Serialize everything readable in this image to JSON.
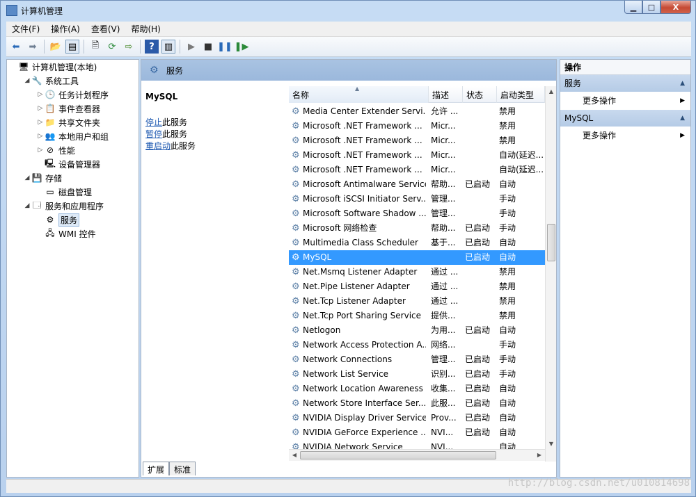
{
  "window": {
    "title": "计算机管理",
    "buttons": {
      "minimize": "▁",
      "maximize": "□",
      "close": "X"
    }
  },
  "menu": [
    "文件(F)",
    "操作(A)",
    "查看(V)",
    "帮助(H)"
  ],
  "toolbar": {
    "icons": [
      "back-arrow-icon",
      "forward-arrow-icon",
      "up-folder-icon",
      "show-hide-tree-icon",
      "properties-icon",
      "refresh-icon",
      "export-list-icon",
      "help-icon",
      "show-hide-action-icon",
      "start-icon",
      "stop-icon",
      "pause-icon",
      "restart-icon"
    ]
  },
  "tree": [
    {
      "label": "计算机管理(本地)",
      "level": 0,
      "toggle": "",
      "icon": "🖥"
    },
    {
      "label": "系统工具",
      "level": 1,
      "toggle": "◢",
      "icon": "🔧"
    },
    {
      "label": "任务计划程序",
      "level": 2,
      "toggle": "▷",
      "icon": "🕒"
    },
    {
      "label": "事件查看器",
      "level": 2,
      "toggle": "▷",
      "icon": "📋"
    },
    {
      "label": "共享文件夹",
      "level": 2,
      "toggle": "▷",
      "icon": "📁"
    },
    {
      "label": "本地用户和组",
      "level": 2,
      "toggle": "▷",
      "icon": "👥"
    },
    {
      "label": "性能",
      "level": 2,
      "toggle": "▷",
      "icon": "⊘"
    },
    {
      "label": "设备管理器",
      "level": 2,
      "toggle": "",
      "icon": "🖳"
    },
    {
      "label": "存储",
      "level": 1,
      "toggle": "◢",
      "icon": "💾"
    },
    {
      "label": "磁盘管理",
      "level": 2,
      "toggle": "",
      "icon": "▭"
    },
    {
      "label": "服务和应用程序",
      "level": 1,
      "toggle": "◢",
      "icon": "🗔"
    },
    {
      "label": "服务",
      "level": 2,
      "toggle": "",
      "icon": "⚙",
      "selected": true
    },
    {
      "label": "WMI 控件",
      "level": 2,
      "toggle": "",
      "icon": "🖧"
    }
  ],
  "middle": {
    "header": "服务",
    "selected_service": "MySQL",
    "links": [
      {
        "link": "停止",
        "rest": "此服务"
      },
      {
        "link": "暂停",
        "rest": "此服务"
      },
      {
        "link": "重启动",
        "rest": "此服务"
      }
    ],
    "tabs": [
      "扩展",
      "标准"
    ]
  },
  "columns": [
    "名称",
    "描述",
    "状态",
    "启动类型"
  ],
  "services": [
    {
      "name": "Media Center Extender Servi...",
      "desc": "允许 ...",
      "status": "",
      "start": "禁用"
    },
    {
      "name": "Microsoft .NET Framework ...",
      "desc": "Micr...",
      "status": "",
      "start": "禁用"
    },
    {
      "name": "Microsoft .NET Framework ...",
      "desc": "Micr...",
      "status": "",
      "start": "禁用"
    },
    {
      "name": "Microsoft .NET Framework ...",
      "desc": "Micr...",
      "status": "",
      "start": "自动(延迟..."
    },
    {
      "name": "Microsoft .NET Framework ...",
      "desc": "Micr...",
      "status": "",
      "start": "自动(延迟..."
    },
    {
      "name": "Microsoft Antimalware Service",
      "desc": "帮助...",
      "status": "已启动",
      "start": "自动"
    },
    {
      "name": "Microsoft iSCSI Initiator Serv...",
      "desc": "管理...",
      "status": "",
      "start": "手动"
    },
    {
      "name": "Microsoft Software Shadow ...",
      "desc": "管理...",
      "status": "",
      "start": "手动"
    },
    {
      "name": "Microsoft 网络检查",
      "desc": "帮助...",
      "status": "已启动",
      "start": "手动"
    },
    {
      "name": "Multimedia Class Scheduler",
      "desc": "基于...",
      "status": "已启动",
      "start": "自动"
    },
    {
      "name": "MySQL",
      "desc": "",
      "status": "已启动",
      "start": "自动",
      "selected": true
    },
    {
      "name": "Net.Msmq Listener Adapter",
      "desc": "通过 ...",
      "status": "",
      "start": "禁用"
    },
    {
      "name": "Net.Pipe Listener Adapter",
      "desc": "通过 ...",
      "status": "",
      "start": "禁用"
    },
    {
      "name": "Net.Tcp Listener Adapter",
      "desc": "通过 ...",
      "status": "",
      "start": "禁用"
    },
    {
      "name": "Net.Tcp Port Sharing Service",
      "desc": "提供...",
      "status": "",
      "start": "禁用"
    },
    {
      "name": "Netlogon",
      "desc": "为用...",
      "status": "已启动",
      "start": "自动"
    },
    {
      "name": "Network Access Protection A...",
      "desc": "网络...",
      "status": "",
      "start": "手动"
    },
    {
      "name": "Network Connections",
      "desc": "管理...",
      "status": "已启动",
      "start": "手动"
    },
    {
      "name": "Network List Service",
      "desc": "识别...",
      "status": "已启动",
      "start": "手动"
    },
    {
      "name": "Network Location Awareness",
      "desc": "收集...",
      "status": "已启动",
      "start": "自动"
    },
    {
      "name": "Network Store Interface Ser...",
      "desc": "此服...",
      "status": "已启动",
      "start": "自动"
    },
    {
      "name": "NVIDIA Display Driver Service",
      "desc": "Prov...",
      "status": "已启动",
      "start": "自动"
    },
    {
      "name": "NVIDIA GeForce Experience ...",
      "desc": "NVI...",
      "status": "已启动",
      "start": "自动"
    },
    {
      "name": "NVIDIA Network Service",
      "desc": "NVI...",
      "status": "",
      "start": "自动"
    }
  ],
  "actions": {
    "title": "操作",
    "sections": [
      {
        "header": "服务",
        "item": "更多操作"
      },
      {
        "header": "MySQL",
        "item": "更多操作"
      }
    ]
  },
  "watermark": "http://blog.csdn.net/u010814698"
}
